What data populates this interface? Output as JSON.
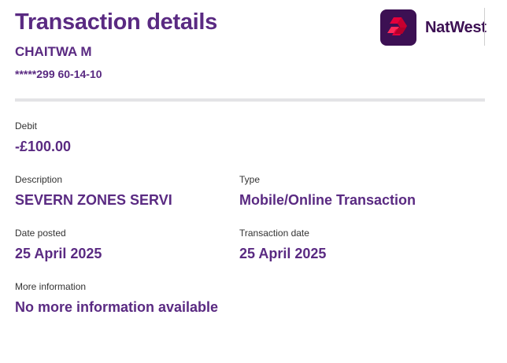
{
  "header": {
    "title": "Transaction details",
    "account_name": "CHAITWA M",
    "account_number": "*****299 60-14-10"
  },
  "logo": {
    "text": "NatWest",
    "icon": "natwest-cubes-icon",
    "colors": {
      "background": "#3c1053",
      "mark": "#e4003b",
      "text": "#3c1053"
    }
  },
  "details": {
    "debit_label": "Debit",
    "debit_value": "-£100.00",
    "description_label": "Description",
    "description_value": "SEVERN ZONES SERVI",
    "type_label": "Type",
    "type_value": "Mobile/Online Transaction",
    "date_posted_label": "Date posted",
    "date_posted_value": "25 April 2025",
    "transaction_date_label": "Transaction date",
    "transaction_date_value": "25 April 2025",
    "more_info_label": "More information",
    "more_info_value": "No more information available"
  },
  "colors": {
    "accent": "#5a2a82",
    "divider": "#e3e3e6"
  }
}
